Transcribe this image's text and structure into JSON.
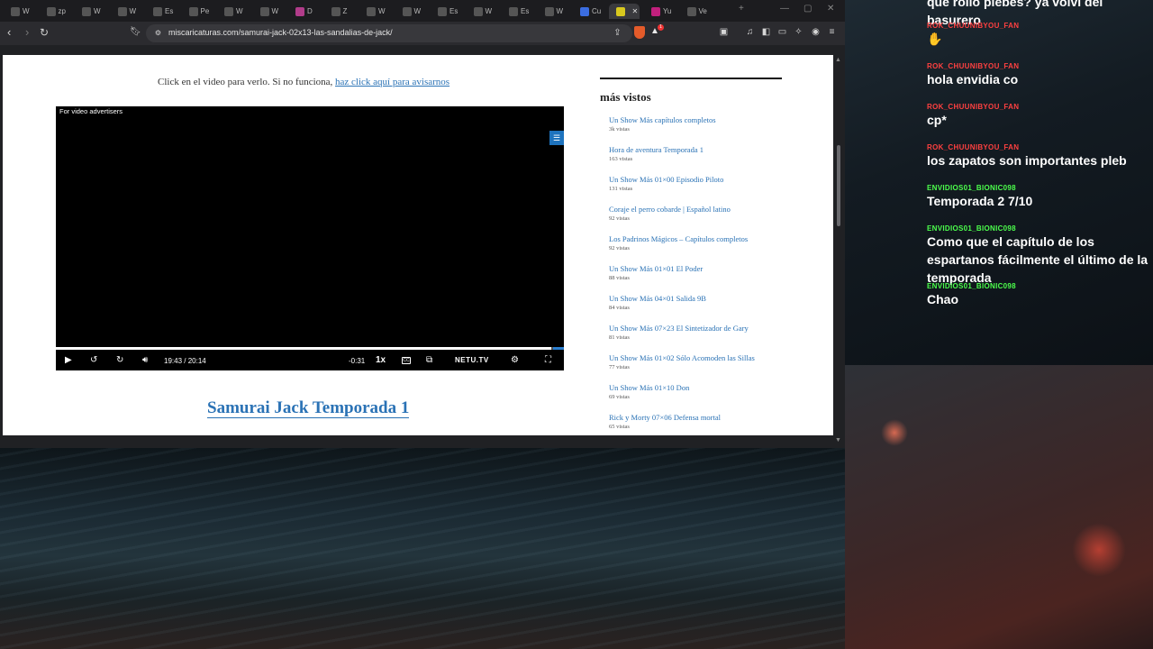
{
  "browser": {
    "url": "miscaricaturas.com/samurai-jack-02x13-las-sandalias-de-jack/",
    "tabs": [
      {
        "label": "W",
        "color": "#555"
      },
      {
        "label": "zp",
        "color": "#555"
      },
      {
        "label": "W",
        "color": "#555"
      },
      {
        "label": "W",
        "color": "#555"
      },
      {
        "label": "Es",
        "color": "#555"
      },
      {
        "label": "Pe",
        "color": "#555"
      },
      {
        "label": "W",
        "color": "#555"
      },
      {
        "label": "W",
        "color": "#555"
      },
      {
        "label": "D",
        "color": "#b13c8a"
      },
      {
        "label": "Z",
        "color": "#555"
      },
      {
        "label": "W",
        "color": "#555"
      },
      {
        "label": "W",
        "color": "#555"
      },
      {
        "label": "Es",
        "color": "#555"
      },
      {
        "label": "W",
        "color": "#555"
      },
      {
        "label": "Es",
        "color": "#555"
      },
      {
        "label": "W",
        "color": "#555"
      },
      {
        "label": "Cu",
        "color": "#3b6de0"
      },
      {
        "label": "",
        "color": "#d8c81e"
      },
      {
        "label": "Yu",
        "color": "#c1207d"
      },
      {
        "label": "Ve",
        "color": "#555"
      }
    ]
  },
  "page": {
    "intro_text": "Click en el video para verlo. Si no funciona, ",
    "intro_link": "haz click aquí para avisarnos",
    "video": {
      "advertiser_label": "For video advertisers",
      "time_current": "19:43",
      "time_total": "20:14",
      "time_remaining": "-0:31",
      "speed": "1x",
      "cc": "CC",
      "brand": "NETU.TV",
      "progress": 0.975
    },
    "season_link": "Samurai Jack Temporada 1"
  },
  "sidebar": {
    "title": "más vistos",
    "items": [
      {
        "title": "Un Show Más capítulos completos",
        "views": "3k vistas"
      },
      {
        "title": "Hora de aventura Temporada 1",
        "views": "163 vistas"
      },
      {
        "title": "Un Show Más 01×00 Episodio Piloto",
        "views": "131 vistas"
      },
      {
        "title": "Coraje el perro cobarde | Español latino",
        "views": "92 vistas"
      },
      {
        "title": "Los Padrinos Mágicos – Capítulos completos",
        "views": "92 vistas"
      },
      {
        "title": "Un Show Más 01×01 El Poder",
        "views": "88 vistas"
      },
      {
        "title": "Un Show Más 04×01 Salida 9B",
        "views": "84 vistas"
      },
      {
        "title": "Un Show Más 07×23 El Sintetizador de Gary",
        "views": "81 vistas"
      },
      {
        "title": "Un Show Más 01×02 Sólo Acomoden las Sillas",
        "views": "77 vistas"
      },
      {
        "title": "Un Show Más 01×10 Don",
        "views": "69 vistas"
      },
      {
        "title": "Rick y Morty 07×06 Defensa mortal",
        "views": "65 vistas"
      }
    ]
  },
  "chat": {
    "messages": [
      {
        "user": "",
        "text": "que rollo plebes? ya volvi del basurero",
        "color": "#ff4040"
      },
      {
        "user": "ROK_CHUUNIBYOU_FAN",
        "text": "✋",
        "color": "#ff4040"
      },
      {
        "user": "ROK_CHUUNIBYOU_FAN",
        "text": "hola envidia co",
        "color": "#ff4040"
      },
      {
        "user": "ROK_CHUUNIBYOU_FAN",
        "text": "cp*",
        "color": "#ff4040"
      },
      {
        "user": "ROK_CHUUNIBYOU_FAN",
        "text": "los zapatos son importantes pleb",
        "color": "#ff4040"
      },
      {
        "user": "ENVIDIOS01_BIONIC098",
        "text": "Temporada 2 7/10",
        "color": "#4cff4c"
      },
      {
        "user": "ENVIDIOS01_BIONIC098",
        "text": "Como que el capítulo de los espartanos fácilmente el último de la temporada",
        "color": "#4cff4c"
      },
      {
        "user": "ENVIDIOS01_BIONIC098",
        "text": "Chao",
        "color": "#4cff4c"
      }
    ]
  }
}
